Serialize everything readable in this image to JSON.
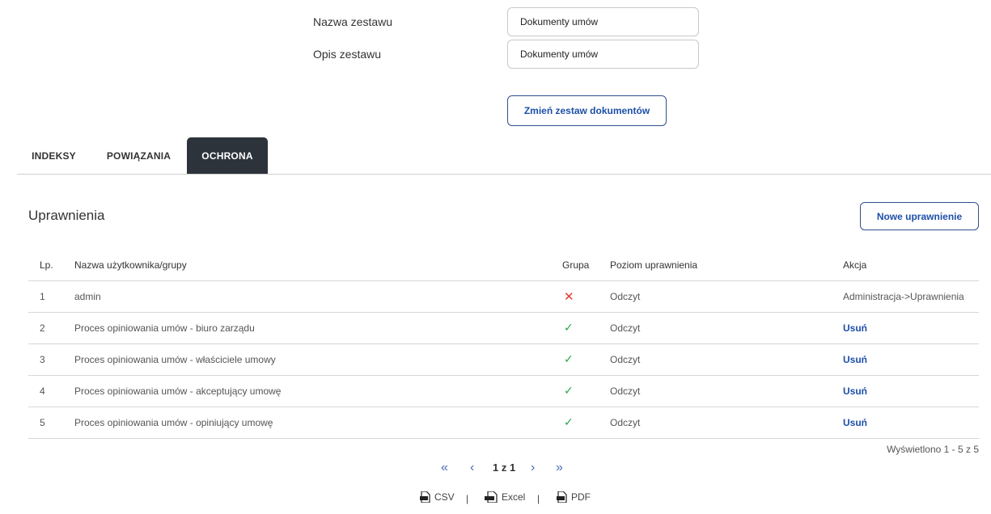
{
  "form": {
    "name_label": "Nazwa zestawu",
    "name_value": "Dokumenty umów",
    "desc_label": "Opis zestawu",
    "desc_value": "Dokumenty umów",
    "change_button": "Zmień zestaw dokumentów"
  },
  "tabs": [
    {
      "label": "INDEKSY"
    },
    {
      "label": "POWIĄZANIA"
    },
    {
      "label": "OCHRONA",
      "active": true
    }
  ],
  "permissions": {
    "title": "Uprawnienia",
    "new_button": "Nowe uprawnienie",
    "columns": {
      "lp": "Lp.",
      "name": "Nazwa użytkownika/grupy",
      "group": "Grupa",
      "level": "Poziom uprawnienia",
      "action": "Akcja"
    },
    "rows": [
      {
        "lp": "1",
        "name": "admin",
        "group_icon": "cross-icon",
        "level": "Odczyt",
        "action": "Administracja->Uprawnienia",
        "action_link": false
      },
      {
        "lp": "2",
        "name": "Proces opiniowania umów - biuro zarządu",
        "group_icon": "check-icon",
        "level": "Odczyt",
        "action": "Usuń",
        "action_link": true
      },
      {
        "lp": "3",
        "name": "Proces opiniowania umów - właściciele umowy",
        "group_icon": "check-icon",
        "level": "Odczyt",
        "action": "Usuń",
        "action_link": true
      },
      {
        "lp": "4",
        "name": "Proces opiniowania umów - akceptujący umowę",
        "group_icon": "check-icon",
        "level": "Odczyt",
        "action": "Usuń",
        "action_link": true
      },
      {
        "lp": "5",
        "name": "Proces opiniowania umów - opiniujący umowę",
        "group_icon": "check-icon",
        "level": "Odczyt",
        "action": "Usuń",
        "action_link": true
      }
    ],
    "showing": "Wyświetlono 1 - 5 z 5"
  },
  "pagination": {
    "page_text": "1 z 1"
  },
  "export": {
    "csv": "CSV",
    "excel": "Excel",
    "pdf": "PDF",
    "separator": "|"
  },
  "colors": {
    "accent": "#1d4fa8",
    "tab_active": "#2d333a",
    "check": "#28a745",
    "cross": "#e53935"
  }
}
